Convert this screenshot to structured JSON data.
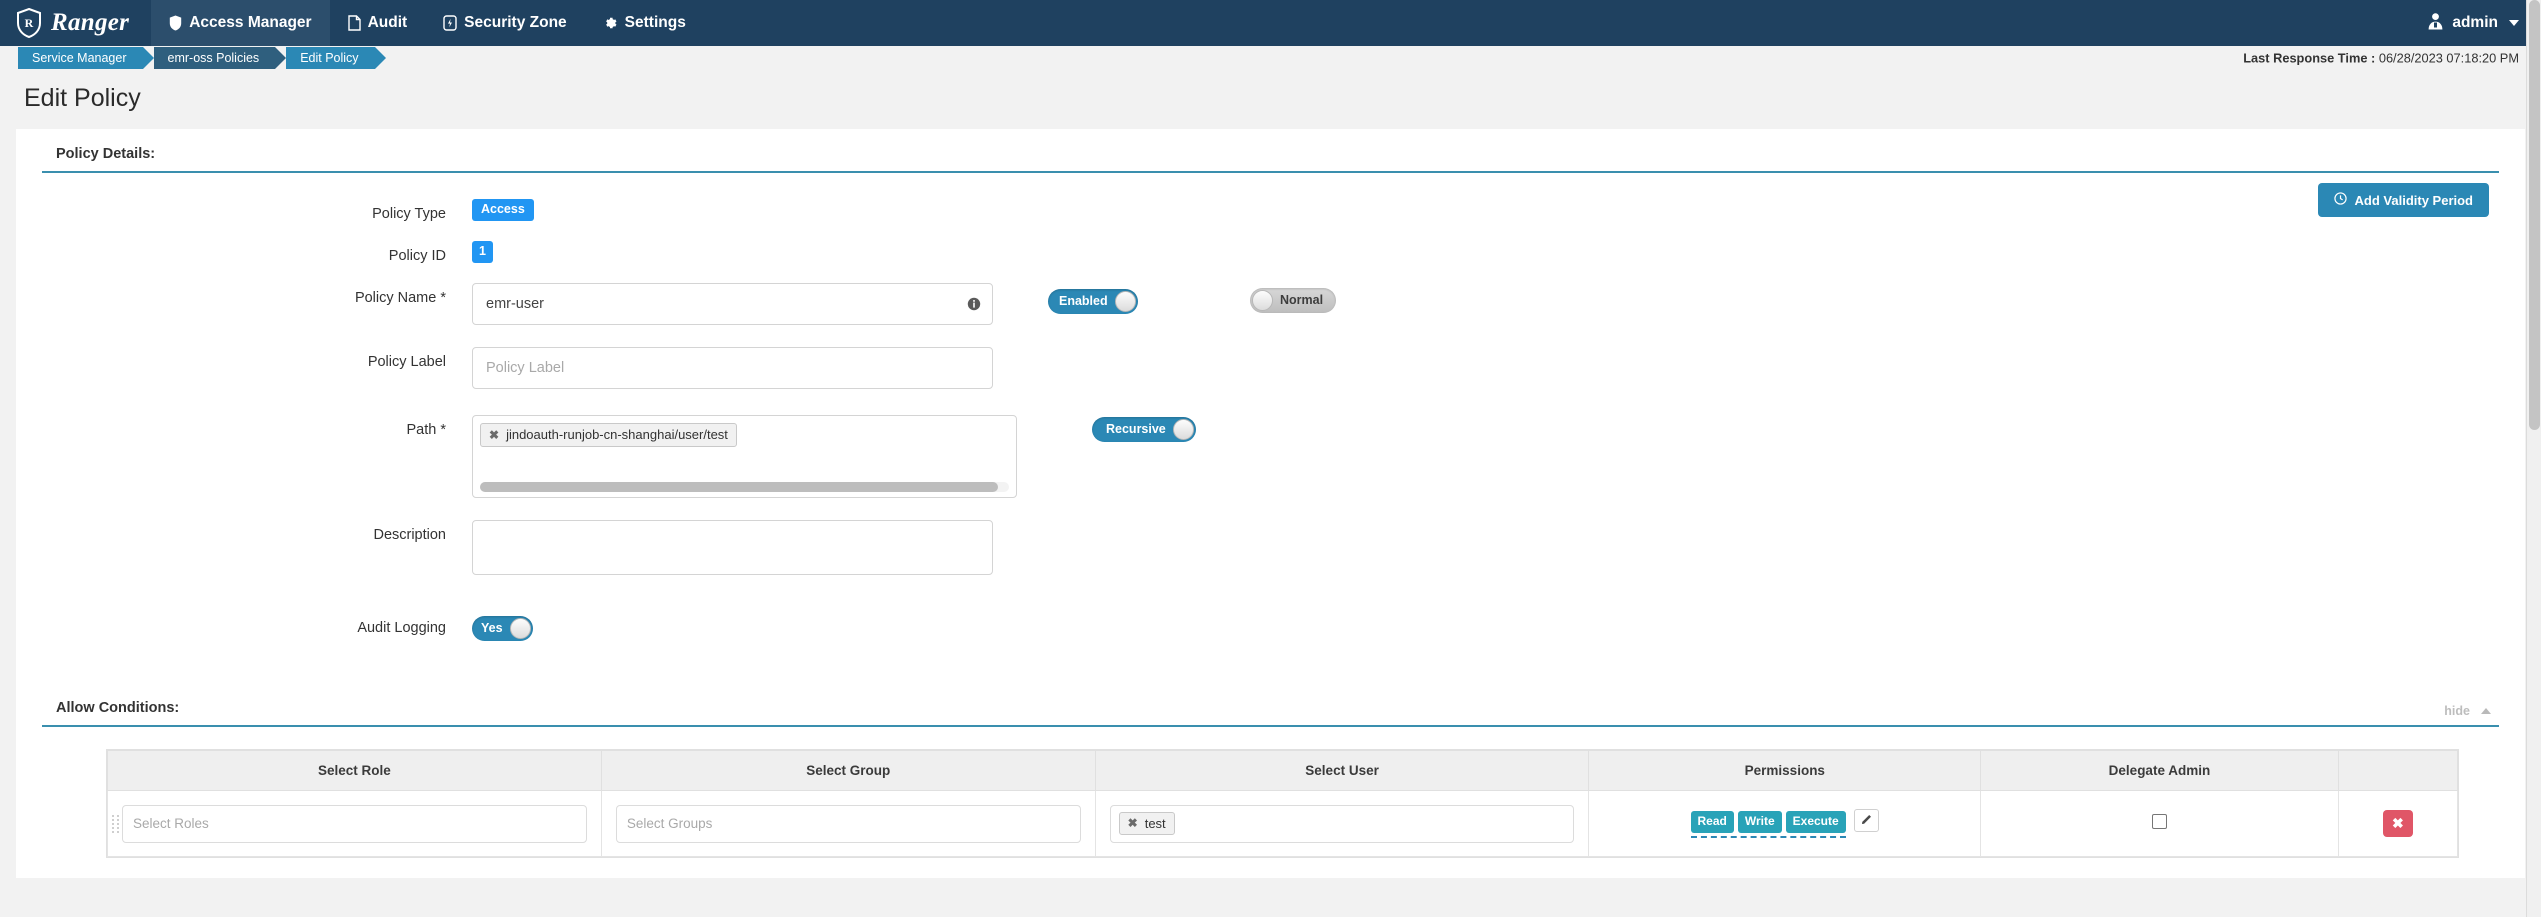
{
  "topnav": {
    "brand": "Ranger",
    "brand_icon": "ranger-shield-logo",
    "items": [
      {
        "label": "Access Manager",
        "icon": "shield-icon",
        "active": true
      },
      {
        "label": "Audit",
        "icon": "file-icon",
        "active": false
      },
      {
        "label": "Security Zone",
        "icon": "zone-icon",
        "active": false
      },
      {
        "label": "Settings",
        "icon": "gear-icon",
        "active": false
      }
    ],
    "user": {
      "label": "admin",
      "icon": "user-avatar-icon"
    }
  },
  "breadcrumb": {
    "items": [
      "Service Manager",
      "emr-oss Policies",
      "Edit Policy"
    ]
  },
  "response_time": {
    "label": "Last Response Time :",
    "value": "06/28/2023 07:18:20 PM"
  },
  "page": {
    "title": "Edit Policy"
  },
  "policy_details": {
    "section_title": "Policy Details:",
    "add_validity_label": "Add Validity Period",
    "add_validity_icon": "clock-icon",
    "fields": {
      "policy_type_label": "Policy Type",
      "policy_type_value": "Access",
      "policy_id_label": "Policy ID",
      "policy_id_value": "1",
      "policy_name_label": "Policy Name *",
      "policy_name_value": "emr-user",
      "policy_name_info_icon": "info-icon",
      "policy_label_label": "Policy Label",
      "policy_label_placeholder": "Policy Label",
      "policy_label_value": "",
      "path_label": "Path *",
      "path_token": "jindoauth-runjob-cn-shanghai/user/test",
      "path_token_remove_icon": "close-icon",
      "description_label": "Description",
      "description_value": "",
      "audit_logging_label": "Audit Logging"
    },
    "toggles": {
      "enabled": {
        "label": "Enabled",
        "state": "on"
      },
      "normal": {
        "label": "Normal",
        "state": "off"
      },
      "recursive": {
        "label": "Recursive",
        "state": "on"
      },
      "audit_logging": {
        "label": "Yes",
        "state": "on"
      }
    }
  },
  "allow_conditions": {
    "section_title": "Allow Conditions:",
    "hide_label": "hide",
    "hide_icon": "chevron-up-icon",
    "columns": [
      "Select Role",
      "Select Group",
      "Select User",
      "Permissions",
      "Delegate Admin",
      ""
    ],
    "rows": [
      {
        "role_placeholder": "Select Roles",
        "role_value": "",
        "group_placeholder": "Select Groups",
        "group_value": "",
        "user_token": "test",
        "user_token_remove_icon": "close-icon",
        "permissions": [
          "Read",
          "Write",
          "Execute"
        ],
        "permissions_edit_icon": "pencil-icon",
        "delegate_admin_checked": false,
        "delete_label": "✖",
        "delete_icon": "close-icon"
      }
    ]
  },
  "colors": {
    "navbar": "#1f4160",
    "accent_blue": "#2b88b5",
    "badge_blue": "#2196f3",
    "perm_teal": "#29a3b8",
    "delete_red": "#e05667",
    "section_underline": "#3a8fae"
  }
}
